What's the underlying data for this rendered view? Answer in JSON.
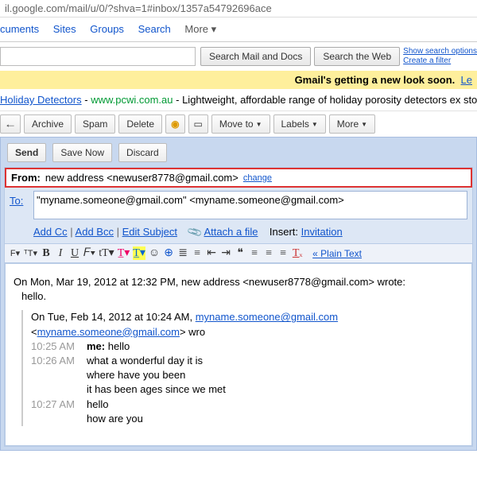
{
  "url": "il.google.com/mail/u/0/?shva=1#inbox/1357a54792696ace",
  "topnav": {
    "items": [
      "cuments",
      "Sites",
      "Groups",
      "Search"
    ],
    "more": "More ▾"
  },
  "search": {
    "btn1": "Search Mail and Docs",
    "btn2": "Search the Web",
    "opt1": "Show search options",
    "opt2": "Create a filter"
  },
  "banner": {
    "bold": "Gmail's getting a new look soon.",
    "link": "Le"
  },
  "ad": {
    "title": "Holiday Detectors",
    "domain": "www.pcwi.com.au",
    "desc": "Lightweight, affordable range of holiday porosity detectors ex stock"
  },
  "toolbar": {
    "archive": "Archive",
    "spam": "Spam",
    "delete": "Delete",
    "moveto": "Move to",
    "labels": "Labels",
    "more": "More"
  },
  "compose": {
    "send": "Send",
    "save": "Save Now",
    "discard": "Discard",
    "from_label": "From:",
    "from_value": "new address <newuser8778@gmail.com>",
    "change": "change",
    "to_label": "To:",
    "to_value": "\"myname.someone@gmail.com\" <myname.someone@gmail.com>",
    "addcc": "Add Cc",
    "addbcc": "Add Bcc",
    "editsubj": "Edit Subject",
    "attach": "Attach a file",
    "insert": "Insert:",
    "invitation": "Invitation",
    "plain": "« Plain Text"
  },
  "body": {
    "line1": "On Mon, Mar 19, 2012 at 12:32 PM, new address <newuser8778@gmail.com> wrote:",
    "hello1": "hello.",
    "line2a": "On Tue, Feb 14, 2012 at 10:24 AM, ",
    "mail1": "myname.someone@gmail.com",
    "mid": " <",
    "mail2": "myname.someone@gmail.com",
    "end": "> wro",
    "r1t": "10:25 AM",
    "r1m": "me: hello",
    "r2t": "10:26 AM",
    "r2m": "what a wonderful day it is",
    "r3m": "where have you been",
    "r4m": "it has been ages since we met",
    "r5t": "10:27 AM",
    "r5m": "hello",
    "r6m": "how are you"
  }
}
